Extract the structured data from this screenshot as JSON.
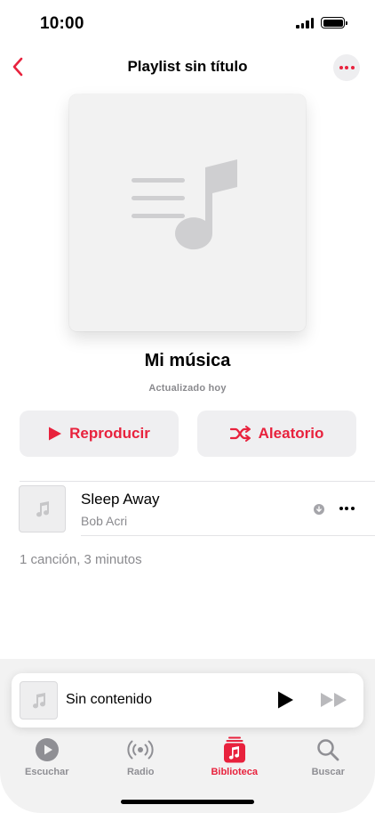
{
  "status_bar": {
    "time": "10:00"
  },
  "nav": {
    "title": "Playlist sin título",
    "back_icon": "chevron-left-icon",
    "more_icon": "ellipsis-icon"
  },
  "playlist": {
    "name": "Mi música",
    "updated": "Actualizado hoy"
  },
  "actions": {
    "play_label": "Reproducir",
    "shuffle_label": "Aleatorio"
  },
  "tracks": [
    {
      "title": "Sleep Away",
      "artist": "Bob Acri",
      "downloaded_icon": "download-arrow-icon"
    }
  ],
  "summary": "1 canción, 3 minutos",
  "mini_player": {
    "title": "Sin contenido"
  },
  "tabs": [
    {
      "label": "Escuchar",
      "icon": "play-circle-icon",
      "active": false
    },
    {
      "label": "Radio",
      "icon": "radio-waves-icon",
      "active": false
    },
    {
      "label": "Biblioteca",
      "icon": "library-icon",
      "active": true
    },
    {
      "label": "Buscar",
      "icon": "search-icon",
      "active": false
    }
  ],
  "colors": {
    "accent": "#e8223d",
    "gray_text": "#8a8a8e",
    "tab_background": "#f2f2f2"
  }
}
